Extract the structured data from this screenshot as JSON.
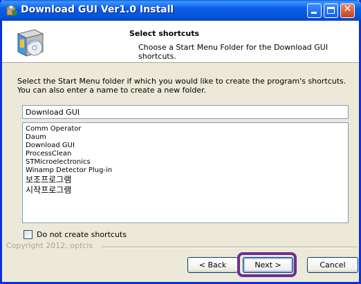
{
  "window": {
    "title": "Download GUI Ver1.0 Install"
  },
  "header": {
    "title": "Select shortcuts",
    "subtitle": "Choose a Start Menu Folder for the Download GUI shortcuts."
  },
  "body": {
    "description": "Select the Start Menu folder if which you would like to create the program's shortcuts. You can also enter a name to create a new folder.",
    "folder_input_value": "Download GUI",
    "folders": [
      "Comm Operator",
      "Daum",
      "Download GUI",
      "ProcessClean",
      "STMicroelectronics",
      "Winamp Detector Plug-in",
      "보조프로그램",
      "시작프로그램"
    ],
    "no_shortcuts_label": "Do not create shortcuts"
  },
  "footer": {
    "copyright": "Copyright 2012, optcis",
    "back_label": "< Back",
    "next_label": "Next >",
    "cancel_label": "Cancel"
  },
  "colors": {
    "titlebar": "#0550d6",
    "highlight": "#6d2f93"
  },
  "icons": [
    "installer-icon",
    "setup-box-icon",
    "minimize-icon",
    "maximize-icon",
    "close-icon"
  ]
}
